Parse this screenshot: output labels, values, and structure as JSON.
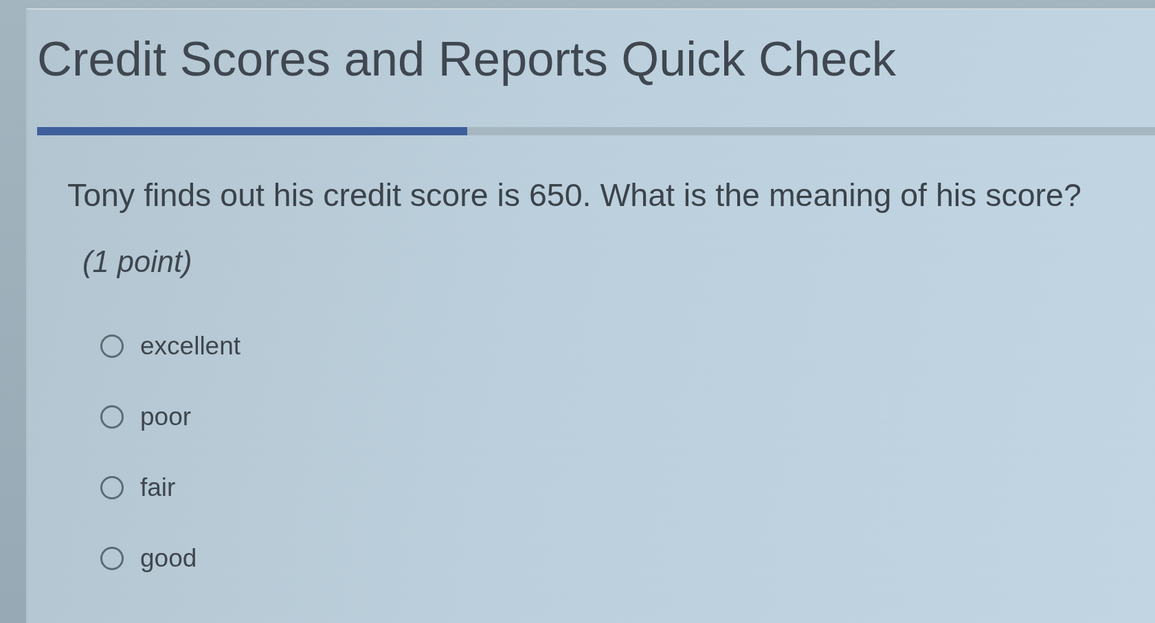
{
  "quiz": {
    "title": "Credit Scores and Reports Quick Check",
    "progress": {
      "level": 0.385
    },
    "question": {
      "text": "Tony finds out his credit score is 650. What is the meaning of his score?",
      "points": "(1 point)",
      "options": [
        {
          "label": "excellent",
          "selected": false
        },
        {
          "label": "poor",
          "selected": false
        },
        {
          "label": "fair",
          "selected": false
        },
        {
          "label": "good",
          "selected": false
        }
      ]
    }
  }
}
